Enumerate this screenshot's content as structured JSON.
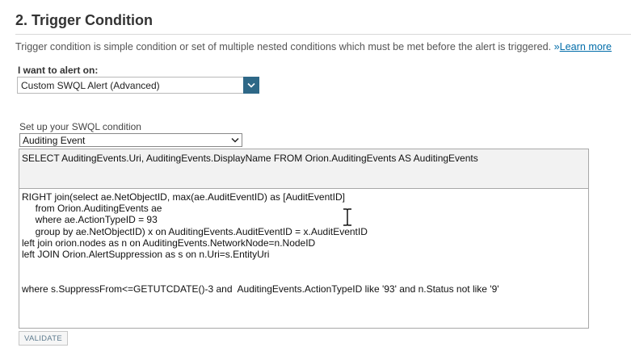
{
  "section": {
    "title": "2. Trigger Condition",
    "description": "Trigger condition is simple condition or set of multiple nested conditions which must be met before the alert is triggered. ",
    "learn_more_prefix": "»",
    "learn_more_label": "Learn more"
  },
  "alert_on": {
    "label": "I want to alert on:",
    "selected": "Custom SWQL Alert (Advanced)"
  },
  "swql": {
    "label": "Set up your SWQL condition",
    "selected": "Auditing Event",
    "query": "SELECT AuditingEvents.Uri, AuditingEvents.DisplayName FROM Orion.AuditingEvents AS AuditingEvents",
    "condition_lines": [
      "RIGHT join(select ae.NetObjectID, max(ae.AuditEventID) as [AuditEventID]",
      "     from Orion.AuditingEvents ae",
      "     where ae.ActionTypeID = 93",
      "     group by ae.NetObjectID) x on AuditingEvents.AuditEventID = x.AuditEventID",
      "left join orion.nodes as n on AuditingEvents.NetworkNode=n.NodeID",
      "left JOIN Orion.AlertSuppression as s on n.Uri=s.EntityUri",
      "",
      "",
      "where s.SuppressFrom<=GETUTCDATE()-3 and  AuditingEvents.ActionTypeID like '93' and n.Status not like '9'"
    ]
  },
  "buttons": {
    "validate_label": "VALIDATE"
  },
  "icons": {
    "alert_select_chevron": "chevron-down-icon",
    "swql_select_chevron": "chevron-down-icon",
    "text_cursor": "i-beam-cursor-icon"
  },
  "colors": {
    "link": "#006ca9",
    "select_accent": "#2e6887",
    "query_bg": "#f2f2f2"
  }
}
